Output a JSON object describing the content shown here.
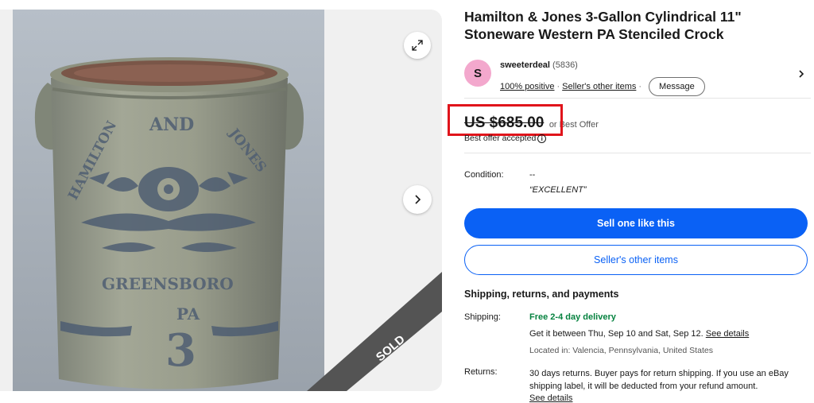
{
  "listing": {
    "title": "Hamilton & Jones 3-Gallon Cylindrical 11\" Stoneware Western PA Stenciled Crock"
  },
  "gallery": {
    "ribbon_label": "SOLD",
    "crock_stencil": [
      "AND",
      "HAMILTON",
      "JONES",
      "GREENSBORO",
      "PA",
      "3"
    ]
  },
  "seller": {
    "avatar_letter": "S",
    "name": "sweeterdeal",
    "feedback_count": "(5836)",
    "positive": "100% positive",
    "other_items": "Seller's other items",
    "message_button": "Message"
  },
  "price": {
    "amount": "US $685.00",
    "or_offer": "or Best Offer",
    "offer_status": "Best offer accepted"
  },
  "condition": {
    "label": "Condition:",
    "value": "--",
    "note": "“EXCELLENT”"
  },
  "actions": {
    "sell_one": "Sell one like this",
    "sellers_items": "Seller's other items"
  },
  "shipping": {
    "heading": "Shipping, returns, and payments",
    "label": "Shipping:",
    "free": "Free 2-4 day delivery",
    "estimate": "Get it between Thu, Sep 10 and Sat, Sep 12.",
    "see_details": "See details",
    "location": "Located in: Valencia, Pennsylvania, United States"
  },
  "returns": {
    "label": "Returns:",
    "text": "30 days returns. Buyer pays for return shipping. If you use an eBay shipping label, it will be deducted from your refund amount.",
    "see_details": "See details"
  },
  "colors": {
    "accent_blue": "#0a61f5",
    "free_green": "#05823f",
    "highlight_red": "#e0141b",
    "avatar_pink": "#f3a8cd"
  },
  "icons": [
    "expand-icon",
    "chevron-right-icon",
    "info-icon"
  ]
}
